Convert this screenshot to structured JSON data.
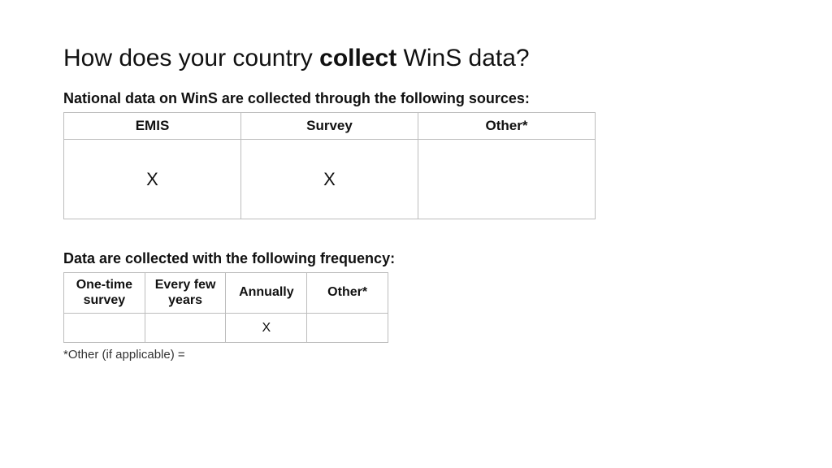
{
  "title_prefix": "How does your country ",
  "title_bold": "collect",
  "title_suffix": " WinS data?",
  "sources": {
    "label": "National data on WinS are collected through the following sources:",
    "headers": [
      "EMIS",
      "Survey",
      "Other*"
    ],
    "row": [
      "X",
      "X",
      ""
    ]
  },
  "frequency": {
    "label": "Data are collected with the following frequency:",
    "headers": [
      "One-time survey",
      "Every few years",
      "Annually",
      "Other*"
    ],
    "row": [
      "",
      "",
      "X",
      ""
    ]
  },
  "footnote": "*Other (if applicable) ="
}
